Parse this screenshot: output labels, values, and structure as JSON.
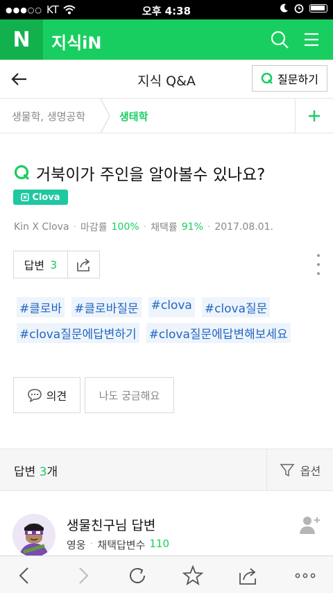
{
  "status_bar": {
    "carrier": "KT",
    "signal_dots": "●●●○○",
    "time": "오후 4:38"
  },
  "appbar": {
    "logo_letter": "N",
    "title": "지식iN",
    "icons": [
      "search-icon",
      "menu-icon"
    ],
    "brand_color": "#19ce60"
  },
  "subheader": {
    "title": "지식 Q&A",
    "ask_button_label": "질문하기"
  },
  "breadcrumb": {
    "parent": "생물학, 생명공학",
    "current": "생태학"
  },
  "question": {
    "title": "거북이가 주인을 알아볼수 있나요?",
    "badge": "Clova",
    "author": "Kin X Clova",
    "close_rate_label": "마감률",
    "close_rate": "100%",
    "adopt_rate_label": "채택률",
    "adopt_rate": "91%",
    "date": "2017.08.01."
  },
  "actions": {
    "answer_label": "답변",
    "answer_count": "3"
  },
  "tags": [
    "#클로바",
    "#클로바질문",
    "#clova",
    "#clova질문",
    "#clova질문에답변하기",
    "#clova질문에답변해보세요"
  ],
  "buttons": {
    "opinion": "의견",
    "curious": "나도 궁금해요"
  },
  "answers_header": {
    "label": "답변",
    "count": "3",
    "unit": "개",
    "options": "옵션"
  },
  "answerer": {
    "name": "생물친구님 답변",
    "rank": "영웅",
    "adopted_label": "채택답변수",
    "adopted_count": "110"
  },
  "bottom_toolbar": {
    "icons": [
      "back-icon",
      "forward-icon",
      "refresh-icon",
      "bookmark-star-icon",
      "share-icon",
      "more-icon"
    ]
  }
}
